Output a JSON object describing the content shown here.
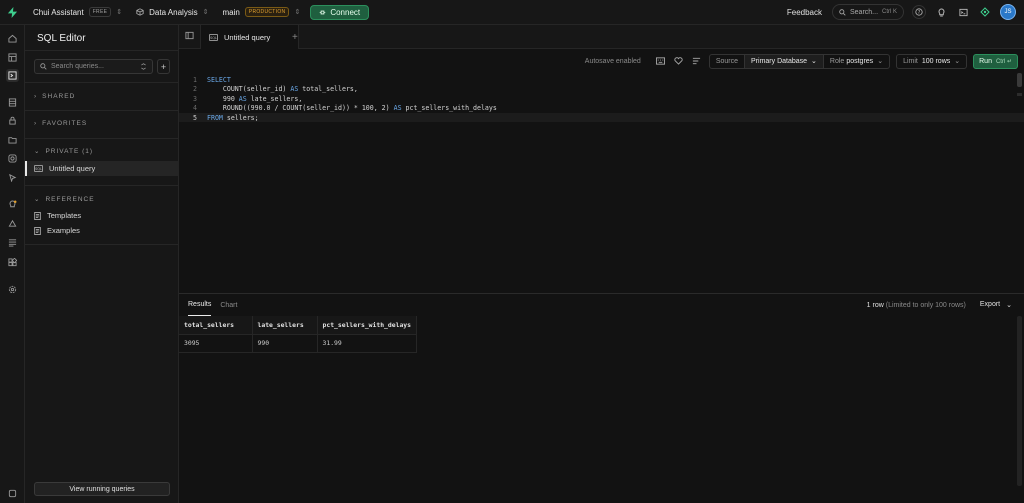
{
  "topbar": {
    "org": "Chui Assistant",
    "org_badge": "FREE",
    "project": "Data Analysis",
    "branch": "main",
    "branch_badge": "PRODUCTION",
    "connect_label": "Connect",
    "feedback_label": "Feedback",
    "search_placeholder": "Search...",
    "search_shortcut": "Ctrl K",
    "avatar_initials": "JS"
  },
  "sidebar": {
    "title": "SQL Editor",
    "search_placeholder": "Search queries...",
    "sections": {
      "shared": "SHARED",
      "favorites": "FAVORITES",
      "private": "PRIVATE (1)",
      "reference": "REFERENCE"
    },
    "private_items": [
      "Untitled query"
    ],
    "reference_items": [
      "Templates",
      "Examples"
    ],
    "bottom_button": "View running queries"
  },
  "tabs": {
    "active_tab": "Untitled query"
  },
  "toolbar": {
    "autosave": "Autosave enabled",
    "source_label": "Source",
    "source_value": "Primary Database",
    "role_label": "Role",
    "role_value": "postgres",
    "limit_label": "Limit",
    "limit_value": "100 rows",
    "run_label": "Run",
    "run_shortcut": "Ctrl ↵"
  },
  "editor": {
    "lines": [
      {
        "n": "1",
        "text": "SELECT"
      },
      {
        "n": "2",
        "text": "    COUNT(seller_id) AS total_sellers,"
      },
      {
        "n": "3",
        "text": "    990 AS late_sellers,"
      },
      {
        "n": "4",
        "text": "    ROUND((990.0 / COUNT(seller_id)) * 100, 2) AS pct_sellers_with_delays"
      },
      {
        "n": "5",
        "text": "FROM sellers;"
      }
    ]
  },
  "results": {
    "tab_results": "Results",
    "tab_chart": "Chart",
    "row_count": "1 row",
    "row_note": "(Limited to only 100 rows)",
    "export_label": "Export",
    "columns": [
      "total_sellers",
      "late_sellers",
      "pct_sellers_with_delays"
    ],
    "rows": [
      [
        "3095",
        "990",
        "31.99"
      ]
    ]
  }
}
